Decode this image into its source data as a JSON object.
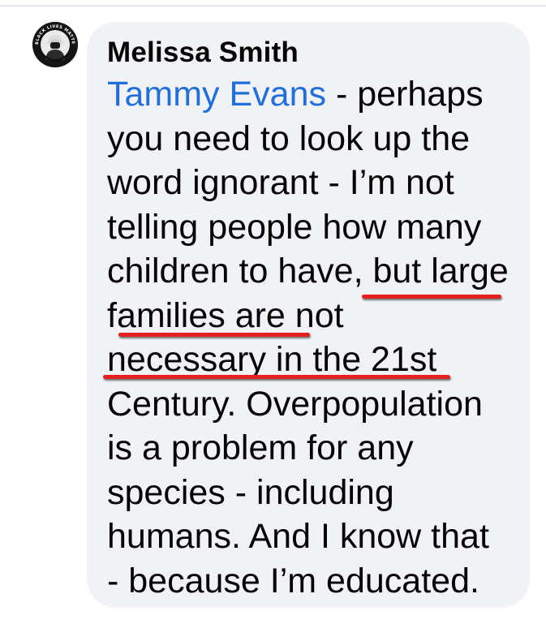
{
  "comment": {
    "author": "Melissa Smith",
    "mention": "Tammy Evans",
    "lines": [
      " - perhaps",
      "you need to look up the",
      "word ignorant - I’m not",
      "telling people how many",
      "children to have, but large",
      "families are not",
      "necessary in the 21st",
      "Century. Overpopulation",
      "is a problem for any",
      "species - including",
      "humans. And I know that",
      "- because I’m educated."
    ]
  },
  "avatar": {
    "ring_text": "BLACK LIVES MATTER"
  },
  "annotation": {
    "underline_color": "#e61f1f"
  }
}
